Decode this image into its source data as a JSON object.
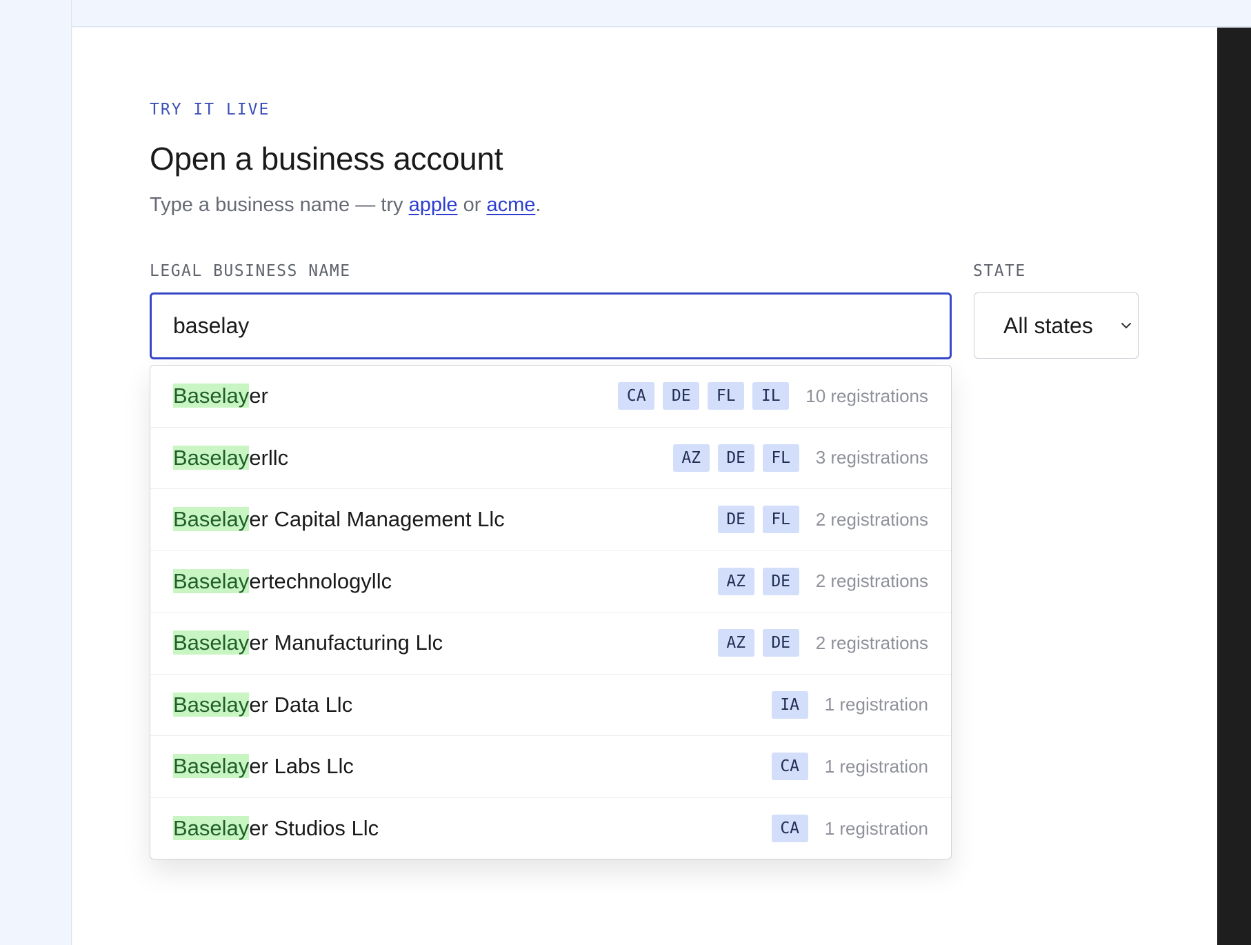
{
  "header": {
    "eyebrow": "TRY IT LIVE",
    "title": "Open a business account",
    "subtitle_prefix": "Type a business name — try ",
    "link_apple": "apple",
    "subtitle_mid": " or ",
    "link_acme": "acme",
    "subtitle_suffix": "."
  },
  "form": {
    "name_label": "LEGAL BUSINESS NAME",
    "name_value": "baselay",
    "state_label": "STATE",
    "state_value": "All states"
  },
  "results": [
    {
      "match": "Baselay",
      "rest": "er",
      "states": [
        "CA",
        "DE",
        "FL",
        "IL"
      ],
      "count": "10 registrations"
    },
    {
      "match": "Baselay",
      "rest": "erllc",
      "states": [
        "AZ",
        "DE",
        "FL"
      ],
      "count": "3 registrations"
    },
    {
      "match": "Baselay",
      "rest": "er Capital Management Llc",
      "states": [
        "DE",
        "FL"
      ],
      "count": "2 registrations"
    },
    {
      "match": "Baselay",
      "rest": "ertechnologyllc",
      "states": [
        "AZ",
        "DE"
      ],
      "count": "2 registrations"
    },
    {
      "match": "Baselay",
      "rest": "er Manufacturing Llc",
      "states": [
        "AZ",
        "DE"
      ],
      "count": "2 registrations"
    },
    {
      "match": "Baselay",
      "rest": "er Data Llc",
      "states": [
        "IA"
      ],
      "count": "1 registration"
    },
    {
      "match": "Baselay",
      "rest": "er Labs Llc",
      "states": [
        "CA"
      ],
      "count": "1 registration"
    },
    {
      "match": "Baselay",
      "rest": "er Studios Llc",
      "states": [
        "CA"
      ],
      "count": "1 registration"
    }
  ],
  "colors": {
    "accent": "#3547c8",
    "highlight": "#c9f5c3",
    "chip": "#d2defa"
  },
  "icons": {
    "state_chevron": "chevron-down-icon"
  }
}
